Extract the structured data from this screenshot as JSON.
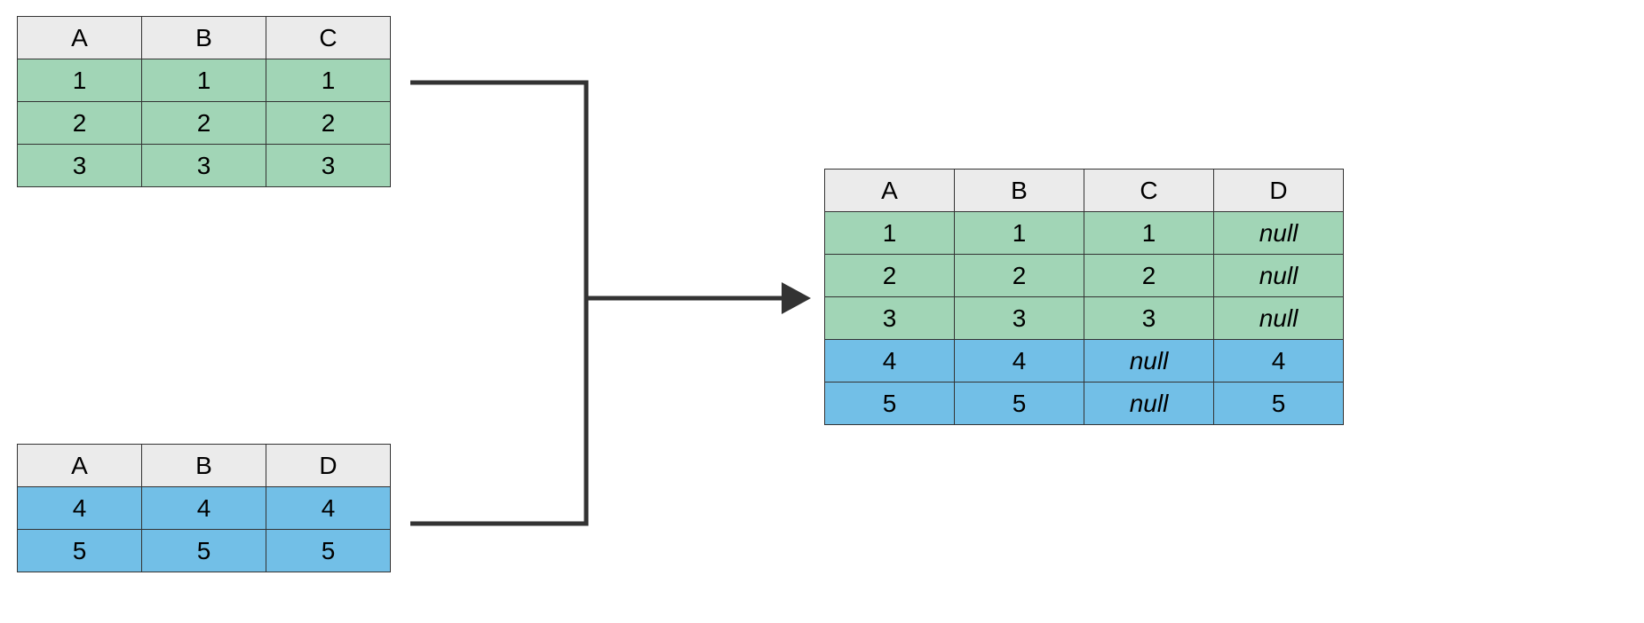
{
  "colors": {
    "header": "#ebebeb",
    "green": "#a1d5b6",
    "blue": "#72bfe7",
    "border": "#333333"
  },
  "table1": {
    "headers": [
      "A",
      "B",
      "C"
    ],
    "rows": [
      {
        "cells": [
          "1",
          "1",
          "1"
        ],
        "color": "green"
      },
      {
        "cells": [
          "2",
          "2",
          "2"
        ],
        "color": "green"
      },
      {
        "cells": [
          "3",
          "3",
          "3"
        ],
        "color": "green"
      }
    ]
  },
  "table2": {
    "headers": [
      "A",
      "B",
      "D"
    ],
    "rows": [
      {
        "cells": [
          "4",
          "4",
          "4"
        ],
        "color": "blue"
      },
      {
        "cells": [
          "5",
          "5",
          "5"
        ],
        "color": "blue"
      }
    ]
  },
  "table3": {
    "headers": [
      "A",
      "B",
      "C",
      "D"
    ],
    "rows": [
      {
        "cells": [
          "1",
          "1",
          "1",
          "null"
        ],
        "color": "green",
        "italicIdx": [
          3
        ]
      },
      {
        "cells": [
          "2",
          "2",
          "2",
          "null"
        ],
        "color": "green",
        "italicIdx": [
          3
        ]
      },
      {
        "cells": [
          "3",
          "3",
          "3",
          "null"
        ],
        "color": "green",
        "italicIdx": [
          3
        ]
      },
      {
        "cells": [
          "4",
          "4",
          "null",
          "4"
        ],
        "color": "blue",
        "italicIdx": [
          2
        ]
      },
      {
        "cells": [
          "5",
          "5",
          "null",
          "5"
        ],
        "color": "blue",
        "italicIdx": [
          2
        ]
      }
    ]
  }
}
